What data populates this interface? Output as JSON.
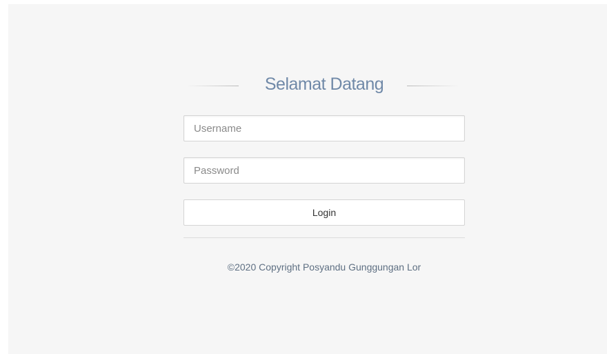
{
  "login": {
    "title": "Selamat Datang",
    "username_placeholder": "Username",
    "password_placeholder": "Password",
    "button_label": "Login"
  },
  "footer": {
    "copyright": "©2020 Copyright Posyandu Gunggungan Lor"
  }
}
